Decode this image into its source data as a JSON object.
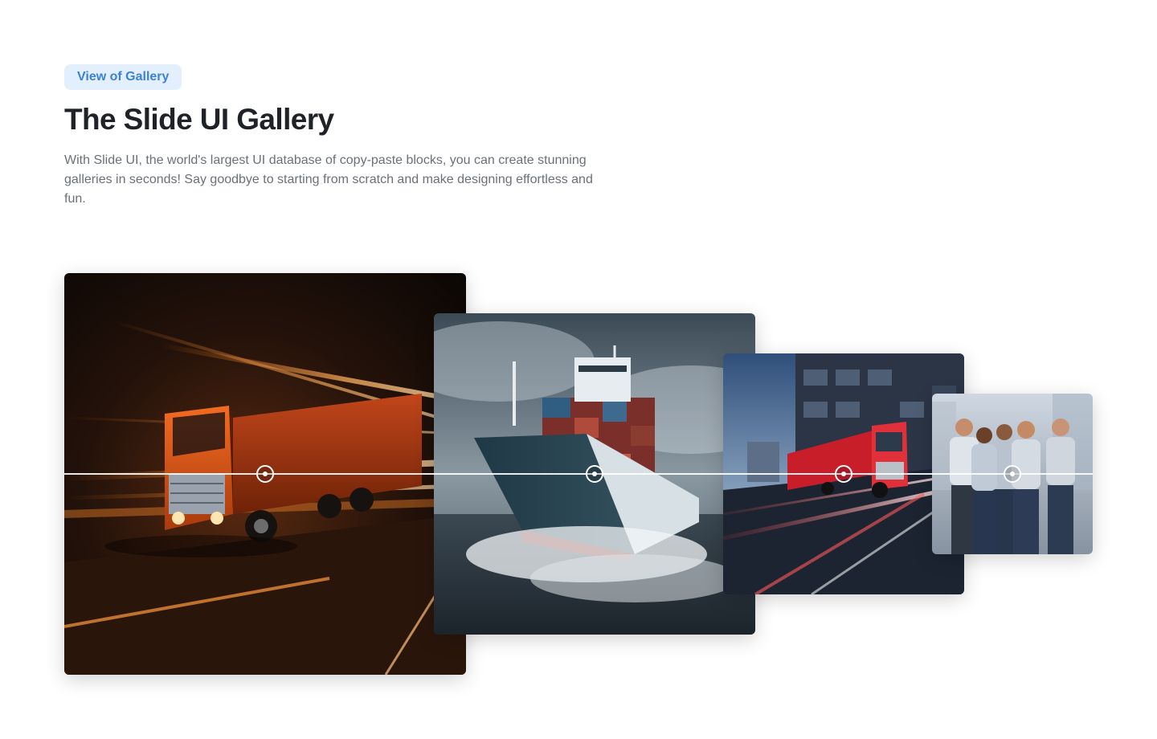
{
  "header": {
    "badge": "View of Gallery",
    "title": "The Slide UI Gallery",
    "description": "With Slide UI, the world's largest UI database of copy-paste blocks, you can create stunning galleries in seconds! Say goodbye to starting from scratch and make designing effortless and fun."
  },
  "gallery": {
    "images": [
      {
        "subject": "orange truck on highway with light trails"
      },
      {
        "subject": "container ship in stormy sea"
      },
      {
        "subject": "red truck on city street at dusk"
      },
      {
        "subject": "team of workers in uniforms"
      }
    ]
  },
  "colors": {
    "badge_bg": "#e3effc",
    "badge_text": "#3b82d6",
    "title": "#1f2328",
    "body_text": "#6b7079"
  }
}
